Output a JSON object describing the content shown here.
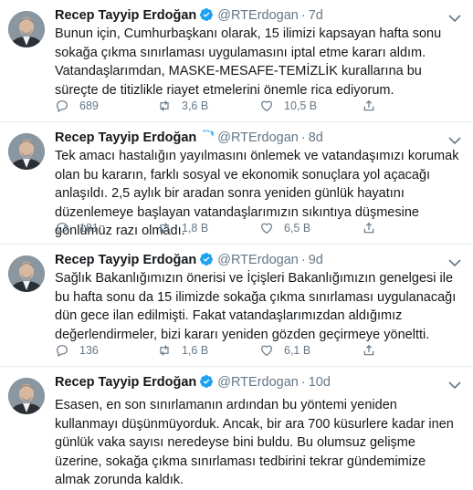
{
  "tweets": [
    {
      "name": "Recep Tayyip Erdoğan",
      "handle": "@RTErdogan",
      "time": "7d",
      "text": "Bunun için, Cumhurbaşkanı olarak, 15 ilimizi kapsayan hafta sonu sokağa çıkma sınırlaması uygulamasını iptal etme kararı aldım. Vatandaşlarımdan, MASKE-MESAFE-TEMİZLİK kurallarına bu süreçte de titizlikle riayet etmelerini önemle rica ediyorum.",
      "replies": "689",
      "retweets": "3,6 B",
      "likes": "10,5 B"
    },
    {
      "name": "Recep Tayyip Erdoğan",
      "handle": "@RTErdogan",
      "time": "8d",
      "text": "Tek amacı hastalığın yayılmasını önlemek ve vatandaşımızı korumak olan bu kararın, farklı sosyal ve ekonomik sonuçlara yol açacağı anlaşıldı. 2,5 aylık bir aradan sonra yeniden günlük hayatını düzenlemeye başlayan vatandaşlarımızın sıkıntıya düşmesine gönlümüz razı olmadı.",
      "replies": "181",
      "retweets": "1,8 B",
      "likes": "6,5 B"
    },
    {
      "name": "Recep Tayyip Erdoğan",
      "handle": "@RTErdogan",
      "time": "9d",
      "text": "Sağlık Bakanlığımızın önerisi ve İçişleri Bakanlığımızın genelgesi ile bu hafta sonu da 15 ilimizde sokağa çıkma sınırlaması uygulanacağı dün gece ilan edilmişti. Fakat vatandaşlarımızdan aldığımız değerlendirmeler, bizi kararı yeniden gözden geçirmeye yöneltti.",
      "replies": "136",
      "retweets": "1,6 B",
      "likes": "6,1 B"
    },
    {
      "name": "Recep Tayyip Erdoğan",
      "handle": "@RTErdogan",
      "time": "10d",
      "text": "Esasen, en son sınırlamanın ardından bu yöntemi yeniden kullanmayı düşünmüyorduk. Ancak, bir ara 700 küsurlere kadar inen günlük vaka sayısı neredeyse bini buldu. Bu olumsuz gelişme üzerine, sokağa çıkma sınırlaması tedbirini tekrar gündemimize almak zorunda kaldık.",
      "replies": "",
      "retweets": "",
      "likes": ""
    }
  ],
  "colors": {
    "text": "#14171a",
    "muted": "#657786",
    "verified": "#1da1f2",
    "divider": "#e6ecf0"
  }
}
